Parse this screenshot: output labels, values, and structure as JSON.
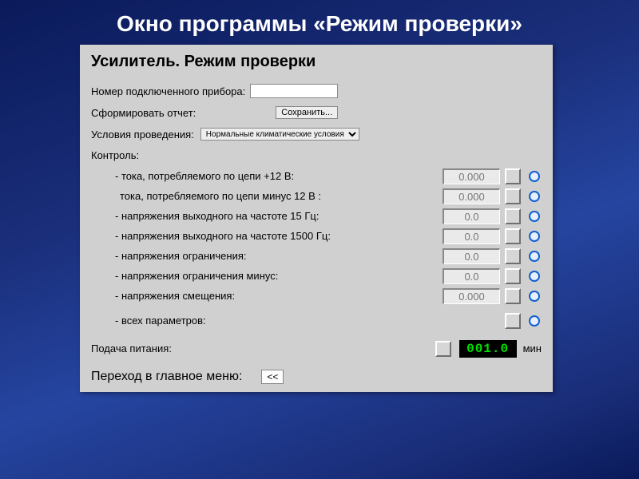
{
  "slide": {
    "title": "Окно программы «Режим проверки»"
  },
  "app": {
    "title": "Усилитель. Режим проверки",
    "deviceNumLabel": "Номер подключенного прибора:",
    "deviceNumValue": "",
    "reportLabel": "Сформировать отчет:",
    "saveLabel": "Сохранить...",
    "conditionsLabel": "Условия проведения:",
    "conditionsSelected": "Нормальные климатические условия",
    "controlHeading": "Контроль:",
    "controls": [
      {
        "label": "- тока, потребляемого по цепи +12 В:",
        "value": "0.000",
        "shift": false
      },
      {
        "label": "тока, потребляемого по цепи минус 12 В :",
        "value": "0.000",
        "shift": true
      },
      {
        "label": "- напряжения выходного на частоте 15 Гц:",
        "value": "0.0",
        "shift": false
      },
      {
        "label": "- напряжения выходного на частоте 1500 Гц:",
        "value": "0.0",
        "shift": false
      },
      {
        "label": "- напряжения ограничения:",
        "value": "0.0",
        "shift": false
      },
      {
        "label": "- напряжения ограничения минус:",
        "value": "0.0",
        "shift": false
      },
      {
        "label": "- напряжения смещения:",
        "value": "0.000",
        "shift": false
      }
    ],
    "allParamsLabel": "- всех параметров:",
    "powerLabel": "Подача питания:",
    "powerValue": "001.0",
    "powerUnit": "мин",
    "backLabel": "Переход в главное меню:",
    "backBtn": "<<"
  }
}
